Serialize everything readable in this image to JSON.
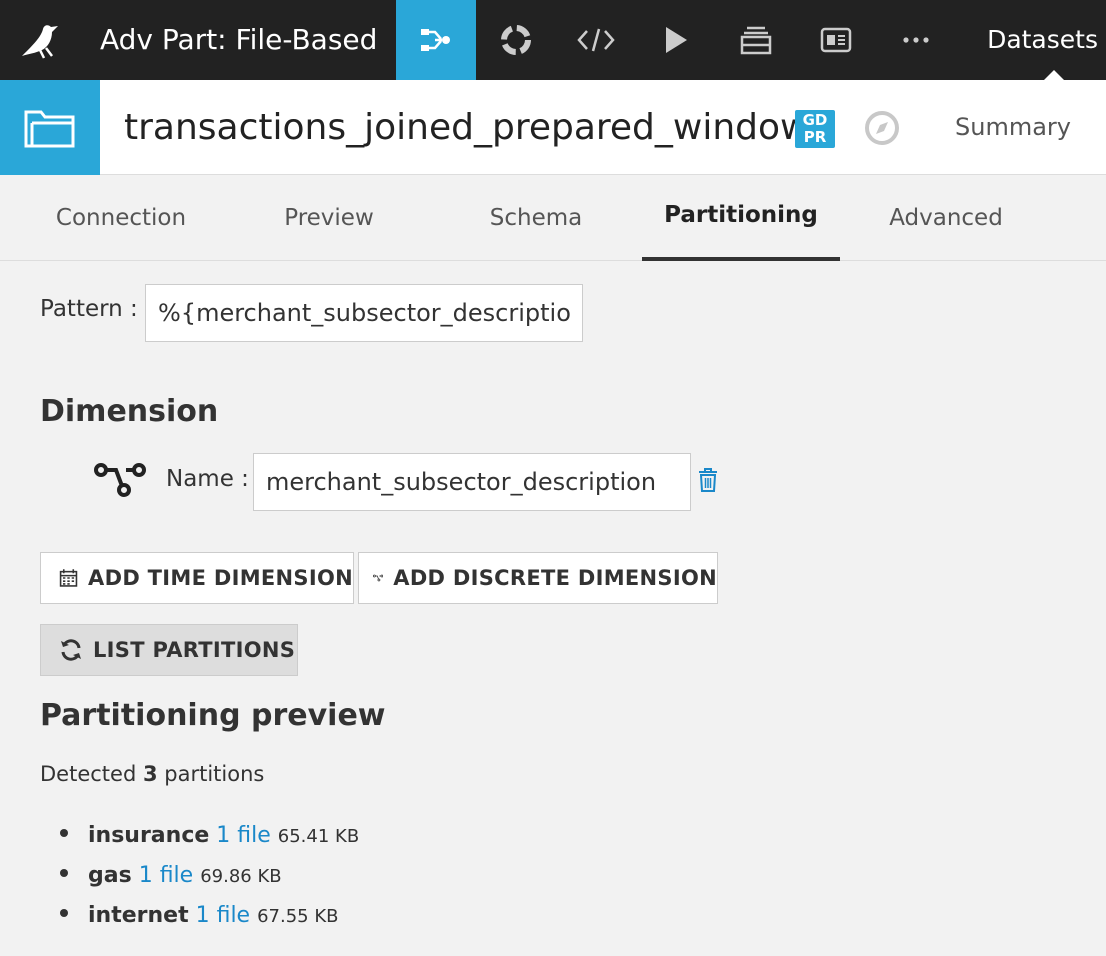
{
  "nav": {
    "project_title": "Adv Part: File-Based",
    "datasets_label": "Datasets",
    "icons": [
      "flow-icon",
      "lifecycle-icon",
      "code-icon",
      "run-icon",
      "datasets-stack-icon",
      "dashboard-icon",
      "more-icon"
    ],
    "active_color": "#2aa7d8"
  },
  "dataset": {
    "name": "transactions_joined_prepared_windows",
    "gdpr_line1": "GD",
    "gdpr_line2": "PR",
    "summary_label": "Summary"
  },
  "tabs": [
    {
      "label": "Connection"
    },
    {
      "label": "Preview"
    },
    {
      "label": "Schema"
    },
    {
      "label": "Partitioning",
      "active": true
    },
    {
      "label": "Advanced"
    }
  ],
  "pattern": {
    "label": "Pattern :",
    "value": "%{merchant_subsector_description}"
  },
  "dimension": {
    "heading": "Dimension",
    "name_label": "Name :",
    "name_value": "merchant_subsector_description"
  },
  "buttons": {
    "add_time": "ADD TIME DIMENSION",
    "add_discrete": "ADD DISCRETE DIMENSION",
    "list_partitions": "LIST PARTITIONS"
  },
  "preview": {
    "heading": "Partitioning preview",
    "detected_prefix": "Detected",
    "detected_count": "3",
    "detected_suffix": "partitions",
    "partitions": [
      {
        "name": "insurance",
        "files": "1 file",
        "size": "65.41 KB"
      },
      {
        "name": "gas",
        "files": "1 file",
        "size": "69.86 KB"
      },
      {
        "name": "internet",
        "files": "1 file",
        "size": "67.55 KB"
      }
    ]
  }
}
